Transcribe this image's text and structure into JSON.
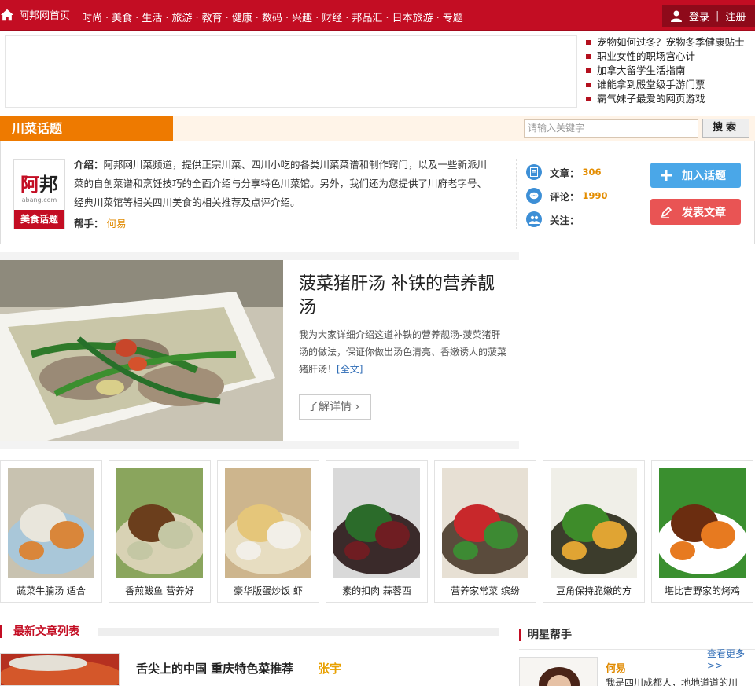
{
  "nav": {
    "home": "阿邦网首页",
    "links": [
      "时尚",
      "美食",
      "生活",
      "旅游",
      "教育",
      "健康",
      "数码",
      "兴趣",
      "财经",
      "邦品汇",
      "日本旅游",
      "专题"
    ],
    "login": "登录",
    "separator": "|",
    "register": "注册"
  },
  "headlines": [
    "宠物如何过冬？宠物冬季健康贴士",
    "职业女性的职场宫心计",
    "加拿大留学生活指南",
    "谁能拿到殿堂级手游门票",
    "霸气妹子最爱的网页游戏"
  ],
  "topic": {
    "title": "川菜话题",
    "search_placeholder": "请输入关键字",
    "search_button": "搜索"
  },
  "info": {
    "logo_text_red": "阿",
    "logo_text_black": "邦",
    "logo_url": "abang.com",
    "logo_tag": "美食话题",
    "intro_label": "介绍：",
    "intro_text": "阿邦网川菜频道，提供正宗川菜、四川小吃的各类川菜菜谱和制作窍门，以及一些新派川菜的自创菜谱和烹饪技巧的全面介绍与分享特色川菜馆。另外，我们还为您提供了川府老字号、经典川菜馆等相关四川美食的相关推荐及点评介绍。",
    "helper_label": "帮手：",
    "helper_name": "何易",
    "stats": [
      {
        "label": "文章：",
        "value": "306",
        "icon": "document-icon"
      },
      {
        "label": "评论：",
        "value": "1990",
        "icon": "comment-icon"
      },
      {
        "label": "关注：",
        "value": "",
        "icon": "users-icon"
      }
    ],
    "join_button": "加入话题",
    "post_button": "发表文章"
  },
  "feature": {
    "title": "菠菜猪肝汤 补铁的营养靓汤",
    "desc": "我为大家详细介绍这道补铁的营养靓汤-菠菜猪肝汤的做法，保证你做出汤色清亮、香嫩诱人的菠菜猪肝汤！",
    "full_link": "[全文]",
    "more_button": "了解详情"
  },
  "thumbs": [
    {
      "caption": "蔬菜牛腩汤 适合",
      "colors": [
        "#a9c7d9",
        "#e9e6dc",
        "#d9863a",
        "#c8c2b0"
      ]
    },
    {
      "caption": "香煎鲅鱼 营养好",
      "colors": [
        "#d8d2b4",
        "#6b3e1c",
        "#c4c7a4",
        "#8aa55d"
      ]
    },
    {
      "caption": "豪华版蛋炒饭 虾",
      "colors": [
        "#e7ddc1",
        "#e5c67a",
        "#f2efe8",
        "#cdb58d"
      ]
    },
    {
      "caption": "素的扣肉 蒜蓉西",
      "colors": [
        "#3a2a2a",
        "#2b6b2a",
        "#6f1d22",
        "#d9d9d9"
      ]
    },
    {
      "caption": "营养家常菜 缤纷",
      "colors": [
        "#5a4b3c",
        "#c8282b",
        "#3d8a33",
        "#e7e0d4"
      ]
    },
    {
      "caption": "豆角保持脆嫩的方",
      "colors": [
        "#3c3c2c",
        "#3e8c2a",
        "#e0a433",
        "#f0efe8"
      ]
    },
    {
      "caption": "堪比吉野家的烤鸡",
      "colors": [
        "#ffffff",
        "#6b2d10",
        "#e77a20",
        "#3a8f2f"
      ]
    }
  ],
  "latest": {
    "title": "最新文章列表",
    "article_title": "舌尖上的中国 重庆特色菜推荐",
    "article_author": "张宇"
  },
  "star": {
    "title": "明星帮手",
    "more": "查看更多>>",
    "name": "何易",
    "desc": "我是四川成都人，地地道道的川"
  },
  "colors": {
    "brand_red": "#c30d23",
    "orange": "#f08300",
    "accent_gold": "#e48d00",
    "blue_button": "#4aa7e8",
    "red_button": "#e95454"
  }
}
